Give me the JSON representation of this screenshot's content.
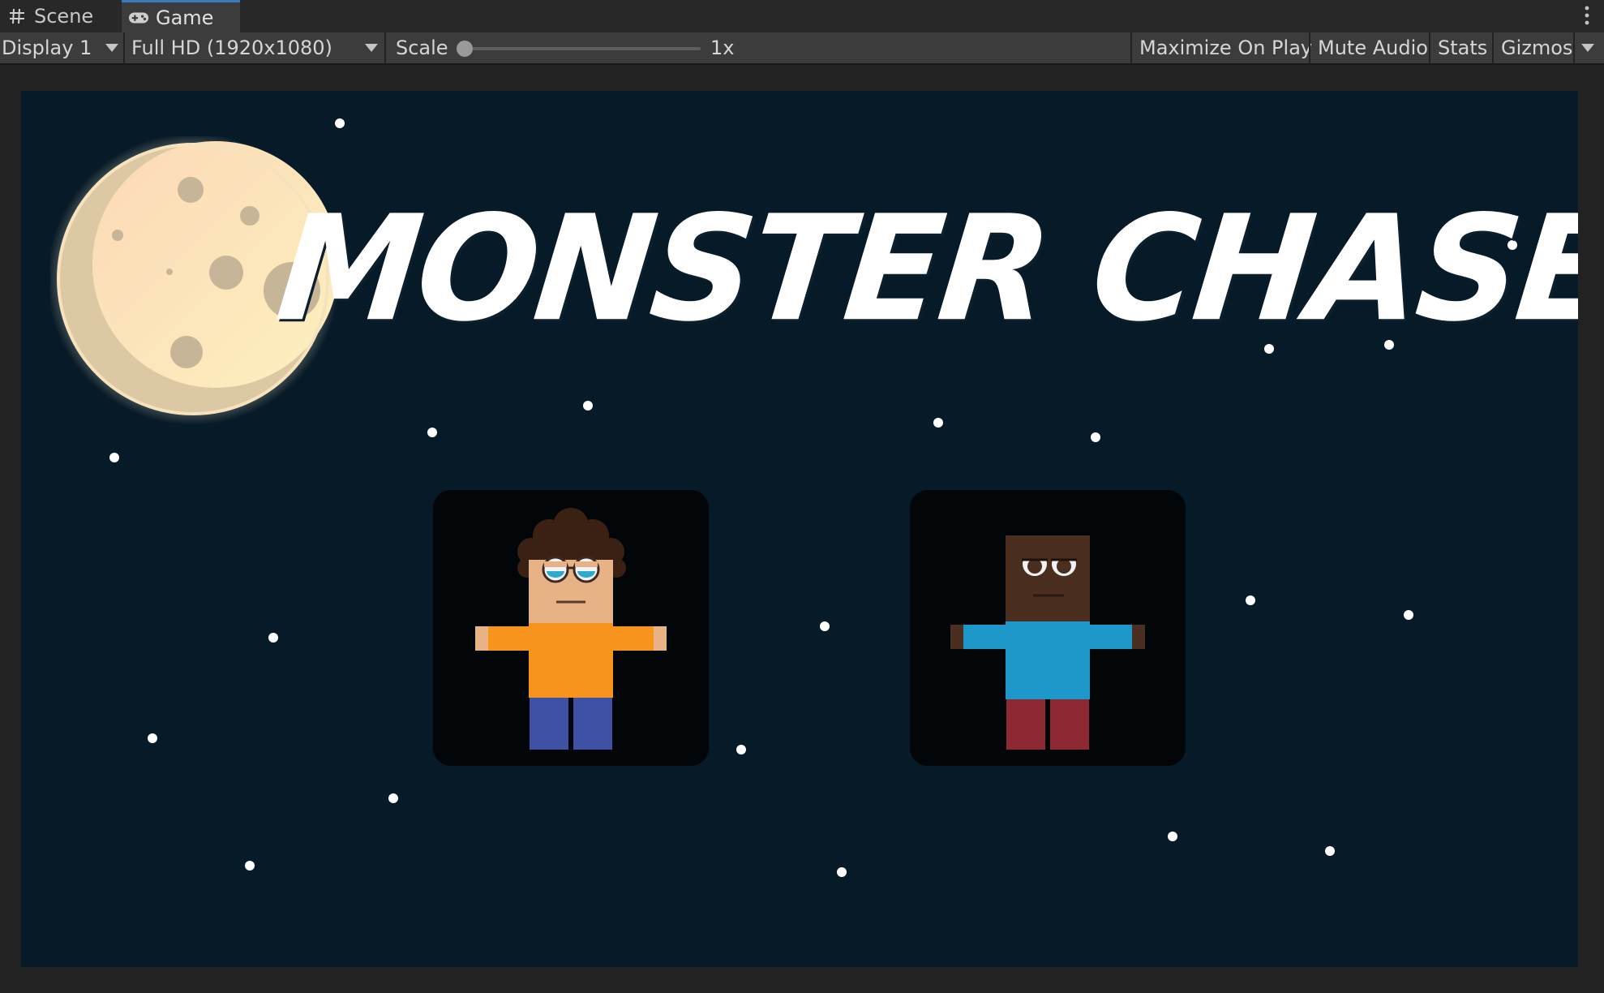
{
  "tabs": {
    "scene_label": "Scene",
    "game_label": "Game",
    "scene_icon": "grid-hash-icon",
    "game_icon": "gamepad-icon"
  },
  "toolbar": {
    "display_value": "Display 1",
    "resolution_value": "Full HD (1920x1080)",
    "scale_label": "Scale",
    "scale_value": "1x",
    "maximize_label": "Maximize On Play",
    "mute_label": "Mute Audio",
    "stats_label": "Stats",
    "gizmos_label": "Gizmos"
  },
  "game": {
    "title": "MONSTER CHASE",
    "players": [
      "player-one-character",
      "player-two-character"
    ]
  },
  "colors": {
    "editor_bg": "#282828",
    "toolbar_bg": "#3c3c3c",
    "tab_accent": "#3a79bb",
    "sky": "#071a27",
    "moon": "#fde9bf",
    "title": "#ffffff",
    "p1_shirt": "#f7941d",
    "p1_pants": "#3f51a5",
    "p2_shirt": "#1e97c9",
    "p2_pants": "#8e2934"
  }
}
